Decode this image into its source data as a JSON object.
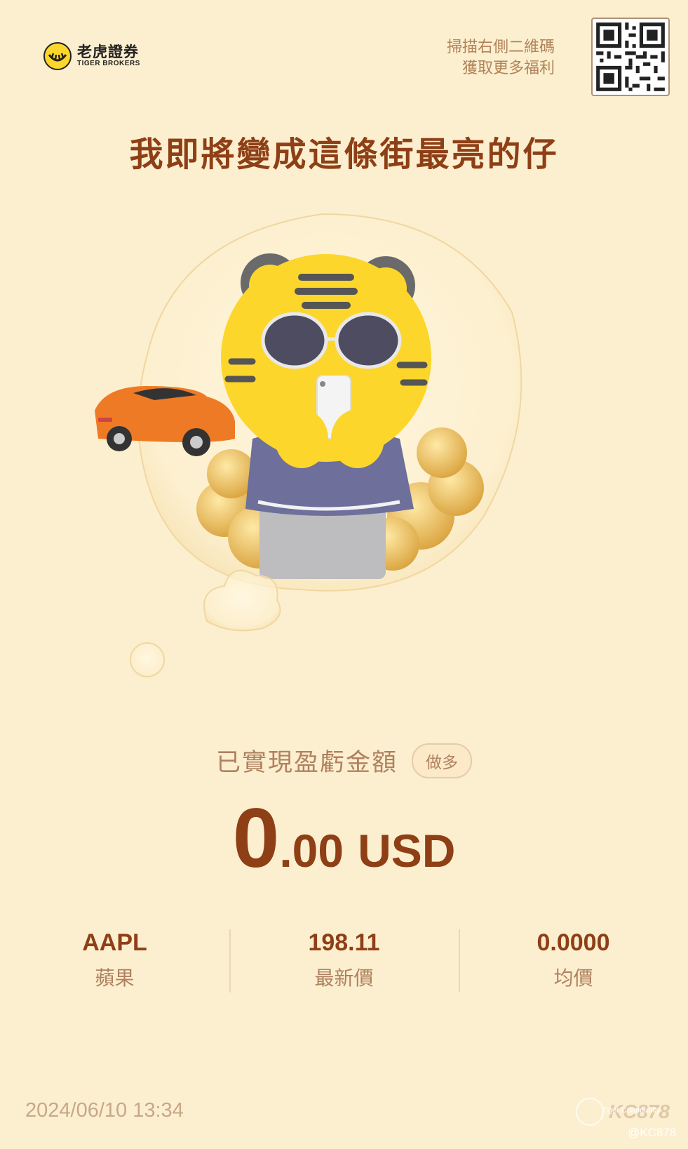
{
  "brand": {
    "name_cn": "老虎證券",
    "name_en": "TIGER BROKERS"
  },
  "promo": {
    "line1": "掃描右側二維碼",
    "line2": "獲取更多福利"
  },
  "headline": "我即將變成這條街最亮的仔",
  "pnl": {
    "label": "已實現盈虧金額",
    "side": "做多",
    "amount_int": "0",
    "amount_dec": ".00",
    "currency": "USD"
  },
  "stats": [
    {
      "value": "AAPL",
      "label": "蘋果"
    },
    {
      "value": "198.11",
      "label": "最新價"
    },
    {
      "value": "0.0000",
      "label": "均價"
    }
  ],
  "timestamp": "2024/06/10 13:34",
  "watermark": {
    "name": "KC878",
    "community": "Tiger Community",
    "handle": "@KC878"
  },
  "colors": {
    "background": "#fcefcf",
    "primary": "#8e3f16",
    "secondary": "#b08160",
    "tiger": "#fcd62a"
  },
  "icons": {
    "logo": "tiger-logo-icon",
    "qr": "qr-code",
    "illustration": "tiger-mascot-with-car-and-coins"
  }
}
